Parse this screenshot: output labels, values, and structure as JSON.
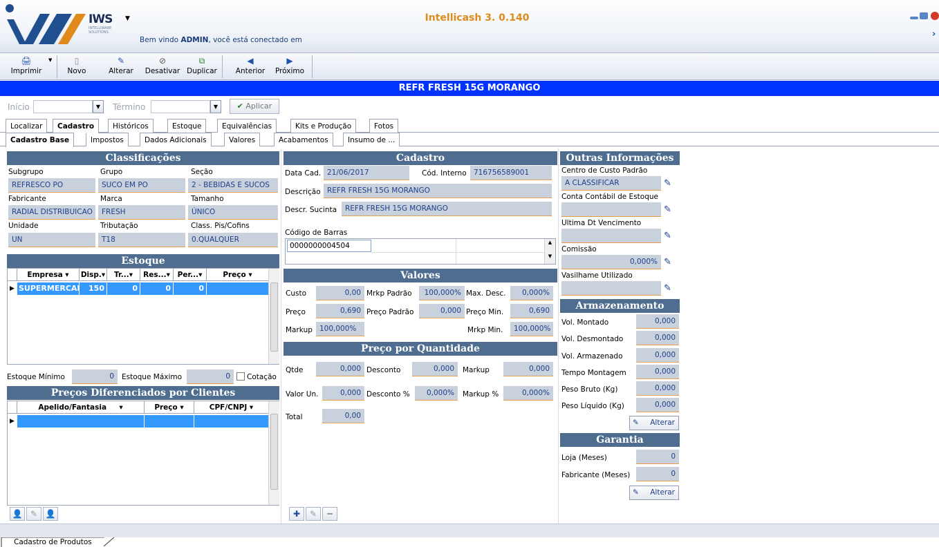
{
  "header": {
    "app_title": "Intellicash 3. 0.140",
    "brand": "IWS",
    "brand_sub": "INTELLIWARE SOLUTIONS",
    "welcome_prefix": "Bem vindo ",
    "welcome_user": "ADMIN",
    "welcome_suffix": ", você está conectado em"
  },
  "toolbar": {
    "print": "Imprimir",
    "new": "Novo",
    "edit": "Alterar",
    "deactivate": "Desativar",
    "duplicate": "Duplicar",
    "prev": "Anterior",
    "next": "Próximo"
  },
  "record_title": "REFR FRESH 15G MORANGO",
  "filter": {
    "start": "Início",
    "end": "Término",
    "apply": "Aplicar"
  },
  "tabs_main": [
    "Localizar",
    "Cadastro",
    "Históricos",
    "Estoque",
    "Equivalências",
    "Kits e Produção",
    "Fotos"
  ],
  "tabs_sub": [
    "Cadastro Base",
    "Impostos",
    "Dados Adicionais",
    "Valores",
    "Acabamentos",
    "Insumo de ..."
  ],
  "classificacoes": {
    "title": "Classificações",
    "subgrupo_label": "Subgrupo",
    "subgrupo": "REFRESCO PO",
    "grupo_label": "Grupo",
    "grupo": "SUCO EM PO",
    "secao_label": "Seção",
    "secao": "2 - BEBIDAS E SUCOS",
    "fabricante_label": "Fabricante",
    "fabricante": "RADIAL DISTRIBUICAO",
    "marca_label": "Marca",
    "marca": "FRESH",
    "tamanho_label": "Tamanho",
    "tamanho": "ÚNICO",
    "unidade_label": "Unidade",
    "unidade": "UN",
    "tributacao_label": "Tributação",
    "tributacao": "T18",
    "pis_label": "Class. Pis/Cofins",
    "pis": "0.QUALQUER"
  },
  "estoque": {
    "title": "Estoque",
    "columns": [
      "Empresa",
      "Disp.",
      "Tr...",
      "Res...",
      "Per...",
      "Preço"
    ],
    "row": [
      "SUPERMERCADO",
      "150",
      "0",
      "0",
      "0",
      ""
    ],
    "min_label": "Estoque Mínimo",
    "min": "0",
    "max_label": "Estoque Máximo",
    "max": "0",
    "cotacao": "Cotação"
  },
  "precos_clientes": {
    "title": "Preços Diferenciados por Clientes",
    "columns": [
      "Apelido/Fantasia",
      "Preço",
      "CPF/CNPJ"
    ]
  },
  "cadastro": {
    "title": "Cadastro",
    "data_label": "Data Cad.",
    "data": "21/06/2017",
    "cod_label": "Cód. Interno",
    "cod": "716756589001",
    "desc_label": "Descrição",
    "desc": "REFR FRESH 15G MORANGO",
    "sucinta_label": "Descr. Sucinta",
    "sucinta": "REFR FRESH 15G MORANGO",
    "barras_label": "Código de Barras",
    "barras": "0000000004504"
  },
  "valores": {
    "title": "Valores",
    "custo_label": "Custo",
    "custo": "0,00",
    "mrkp_padrao_label": "Mrkp Padrão",
    "mrkp_padrao": "100,000%",
    "max_desc_label": "Max. Desc.",
    "max_desc": "0,000%",
    "preco_label": "Preço",
    "preco": "0,690",
    "preco_padrao_label": "Preço Padrão",
    "preco_padrao": "0,000",
    "preco_min_label": "Preço Min.",
    "preco_min": "0,690",
    "markup_label": "Markup",
    "markup": "100,000%",
    "mrkp_min_label": "Mrkp Min.",
    "mrkp_min": "100,000%"
  },
  "preco_qtd": {
    "title": "Preço por Quantidade",
    "qtde_label": "Qtde",
    "qtde": "0,000",
    "desconto_label": "Desconto",
    "desconto": "0,000",
    "markup_label": "Markup",
    "markup": "0,000",
    "valor_un_label": "Valor Un.",
    "valor_un": "0,000",
    "desconto_pct_label": "Desconto %",
    "desconto_pct": "0,000%",
    "markup_pct_label": "Markup %",
    "markup_pct": "0,000%",
    "total_label": "Total",
    "total": "0,00"
  },
  "outras": {
    "title": "Outras Informações",
    "centro_label": "Centro de Custo Padrão",
    "centro": "A CLASSIFICAR",
    "conta_label": "Conta Contábil de Estoque",
    "conta": "",
    "venc_label": "Ultima Dt Vencimento",
    "venc": "",
    "comissao_label": "Comissão",
    "comissao": "0,000%",
    "vasilhame_label": "Vasilhame Utilizado",
    "vasilhame": ""
  },
  "armazenamento": {
    "title": "Armazenamento",
    "rows": [
      {
        "label": "Vol. Montado",
        "value": "0,000"
      },
      {
        "label": "Vol. Desmontado",
        "value": "0,000"
      },
      {
        "label": "Vol. Armazenado",
        "value": "0,000"
      },
      {
        "label": "Tempo Montagem",
        "value": "0,000"
      },
      {
        "label": "Peso Bruto (Kg)",
        "value": "0,000"
      },
      {
        "label": "Peso Líquido (Kg)",
        "value": "0,000"
      }
    ],
    "alterar": "Alterar"
  },
  "garantia": {
    "title": "Garantia",
    "loja_label": "Loja (Meses)",
    "loja": "0",
    "fab_label": "Fabricante (Meses)",
    "fab": "0",
    "alterar": "Alterar"
  },
  "footer_tab": "Cadastro de Produtos",
  "colors": {
    "accent_blue": "#0033ff",
    "section_header": "#4e6d8f",
    "title_orange": "#e08a1b",
    "selection": "#3399ff"
  }
}
